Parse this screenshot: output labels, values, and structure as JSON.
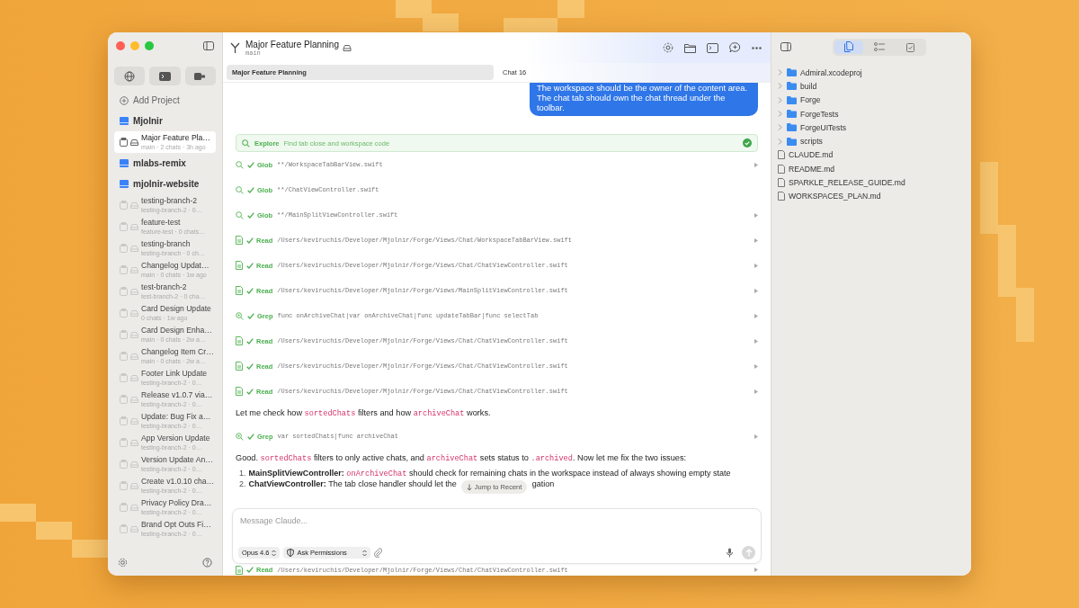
{
  "sidebar": {
    "add_project": "Add Project",
    "projects": [
      {
        "name": "Mjolnir",
        "chats": [
          {
            "title": "Major Feature Pla…",
            "meta": "main · 2 chats · 3h ago",
            "selected": true
          }
        ]
      },
      {
        "name": "mlabs-remix"
      },
      {
        "name": "mjolnir-website",
        "chats": [
          {
            "title": "testing-branch-2",
            "meta": "testing-branch-2 · 0…",
            "selected": false
          },
          {
            "title": "feature-test",
            "meta": "feature-test · 0 chats…",
            "selected": false
          },
          {
            "title": "testing-branch",
            "meta": "testing-branch · 0 ch…",
            "selected": false
          },
          {
            "title": "Changelog Updat…",
            "meta": "main · 0 chats · 1w ago",
            "selected": false
          },
          {
            "title": "test-branch-2",
            "meta": "test-branch-2 · 0 cha…",
            "selected": false
          },
          {
            "title": "Card Design Update",
            "meta": "0 chats · 1w ago",
            "selected": false
          },
          {
            "title": "Card Design Enha…",
            "meta": "main · 0 chats · 2w a…",
            "selected": false
          },
          {
            "title": "Changelog Item Cr…",
            "meta": "main · 0 chats · 2w a…",
            "selected": false
          },
          {
            "title": "Footer Link Update",
            "meta": "testing-branch-2 · 0…",
            "selected": false
          },
          {
            "title": "Release v1.0.7 via…",
            "meta": "testing-branch-2 · 0…",
            "selected": false
          },
          {
            "title": "Update: Bug Fix a…",
            "meta": "testing-branch-2 · 0…",
            "selected": false
          },
          {
            "title": "App Version Update",
            "meta": "testing-branch-2 · 0…",
            "selected": false
          },
          {
            "title": "Version Update An…",
            "meta": "testing-branch-2 · 0…",
            "selected": false
          },
          {
            "title": "Create v1.0.10 cha…",
            "meta": "testing-branch-2 · 0…",
            "selected": false
          },
          {
            "title": "Privacy Policy Dra…",
            "meta": "testing-branch-2 · 0…",
            "selected": false
          },
          {
            "title": "Brand Opt Outs Fi…",
            "meta": "testing-branch-2 · 0…",
            "selected": false
          }
        ]
      }
    ]
  },
  "header": {
    "title": "Major Feature Planning",
    "branch": "main"
  },
  "tabs": [
    {
      "label": "Major Feature Planning",
      "selected": true
    },
    {
      "label": "Chat 16",
      "selected": false
    }
  ],
  "messages": [
    {
      "kind": "user",
      "text": "The workspace should be the owner of the content area. The chat tab should own the chat thread under the toolbar."
    },
    {
      "kind": "task",
      "label": "Explore",
      "detail": "Find tab close and workspace code",
      "done": true
    },
    {
      "kind": "glob",
      "label": "Glob",
      "arg": "**/WorkspaceTabBarView.swift",
      "done": true,
      "expandable": true
    },
    {
      "kind": "glob",
      "label": "Glob",
      "arg": "**/ChatViewController.swift",
      "done": true,
      "expandable": false
    },
    {
      "kind": "glob",
      "label": "Glob",
      "arg": "**/MainSplitViewController.swift",
      "done": true,
      "expandable": true
    },
    {
      "kind": "read",
      "label": "Read",
      "arg": "/Users/keviruchis/Developer/Mjolnir/Forge/Views/Chat/WorkspaceTabBarView.swift",
      "done": true,
      "expandable": true
    },
    {
      "kind": "read",
      "label": "Read",
      "arg": "/Users/keviruchis/Developer/Mjolnir/Forge/Views/Chat/ChatViewController.swift",
      "done": true,
      "expandable": true
    },
    {
      "kind": "read",
      "label": "Read",
      "arg": "/Users/keviruchis/Developer/Mjolnir/Forge/Views/MainSplitViewController.swift",
      "done": true,
      "expandable": true
    },
    {
      "kind": "grep",
      "label": "Grep",
      "arg": "func onArchiveChat|var onArchiveChat|func updateTabBar|func selectTab",
      "done": true,
      "expandable": true
    },
    {
      "kind": "read",
      "label": "Read",
      "arg": "/Users/keviruchis/Developer/Mjolnir/Forge/Views/Chat/ChatViewController.swift",
      "done": true,
      "expandable": true
    },
    {
      "kind": "read",
      "label": "Read",
      "arg": "/Users/keviruchis/Developer/Mjolnir/Forge/Views/Chat/ChatViewController.swift",
      "done": true,
      "expandable": true
    },
    {
      "kind": "read",
      "label": "Read",
      "arg": "/Users/keviruchis/Developer/Mjolnir/Forge/Views/Chat/ChatViewController.swift",
      "done": true,
      "expandable": true
    },
    {
      "kind": "text",
      "parts": [
        {
          "kind": "text",
          "text": "Let me check how "
        },
        {
          "kind": "code",
          "text": "sortedChats"
        },
        {
          "kind": "text",
          "text": " filters and how "
        },
        {
          "kind": "code",
          "text": "archiveChat"
        },
        {
          "kind": "text",
          "text": " works."
        }
      ]
    },
    {
      "kind": "grep",
      "label": "Grep",
      "arg": "var sortedChats|func archiveChat",
      "done": true,
      "expandable": true
    },
    {
      "kind": "text",
      "parts": [
        {
          "kind": "text",
          "text": "Good. "
        },
        {
          "kind": "code",
          "text": "sortedChats"
        },
        {
          "kind": "text",
          "text": " filters to only active chats, and "
        },
        {
          "kind": "code",
          "text": "archiveChat"
        },
        {
          "kind": "text",
          "text": " sets status to "
        },
        {
          "kind": "code",
          "text": ".archived"
        },
        {
          "kind": "text",
          "text": ". Now let me fix the two issues:"
        }
      ]
    },
    {
      "kind": "list",
      "items": [
        {
          "number": "1.",
          "parts": [
            {
              "kind": "bold",
              "text": "MainSplitViewController: "
            },
            {
              "kind": "code",
              "text": "onArchiveChat"
            },
            {
              "kind": "text",
              "text": " should check for remaining chats in the workspace instead of always showing empty state"
            }
          ]
        },
        {
          "number": "2.",
          "parts": [
            {
              "kind": "bold",
              "text": "ChatViewController:"
            },
            {
              "kind": "text",
              "text": " The tab close handler should let the"
            },
            {
              "kind": "gap"
            },
            {
              "kind": "text",
              "text": "gation"
            }
          ]
        }
      ]
    }
  ],
  "jump_button": "Jump to Recent",
  "composer": {
    "placeholder": "Message Claude...",
    "model": "Opus 4.6",
    "permissions": "Ask Permissions"
  },
  "trailing_tool": {
    "kind": "read",
    "label": "Read",
    "arg": "/Users/keviruchis/Developer/Mjolnir/Forge/Views/Chat/ChatViewController.swift",
    "done": true,
    "expandable": true
  },
  "inspector": {
    "segments": [
      {
        "kind": "files",
        "selected": true
      },
      {
        "kind": "list",
        "selected": false
      },
      {
        "kind": "tasks",
        "selected": false
      }
    ],
    "files": [
      {
        "kind": "folder",
        "name": "Admiral.xcodeproj",
        "expanded": false
      },
      {
        "kind": "folder",
        "name": "build",
        "expanded": false
      },
      {
        "kind": "folder",
        "name": "Forge",
        "expanded": false
      },
      {
        "kind": "folder",
        "name": "ForgeTests",
        "expanded": false
      },
      {
        "kind": "folder",
        "name": "ForgeUITests",
        "expanded": false
      },
      {
        "kind": "folder",
        "name": "scripts",
        "expanded": false
      },
      {
        "kind": "file",
        "name": "CLAUDE.md"
      },
      {
        "kind": "file",
        "name": "README.md"
      },
      {
        "kind": "file",
        "name": "SPARKLE_RELEASE_GUIDE.md"
      },
      {
        "kind": "file",
        "name": "WORKSPACES_PLAN.md"
      }
    ]
  }
}
